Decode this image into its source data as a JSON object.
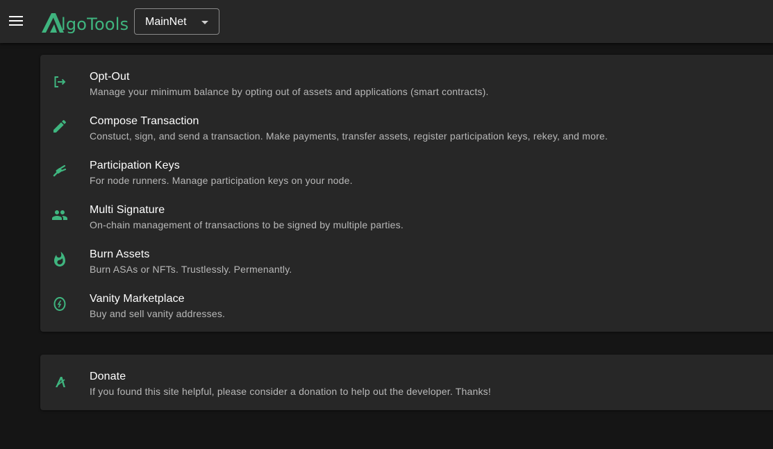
{
  "header": {
    "logo_text": "lgoTools",
    "network_value": "MainNet"
  },
  "tools": [
    {
      "icon": "logout-icon",
      "title": "Opt-Out",
      "description": "Manage your minimum balance by opting out of assets and applications (smart contracts)."
    },
    {
      "icon": "pencil-icon",
      "title": "Compose Transaction",
      "description": "Constuct, sign, and send a transaction. Make payments, transfer assets, register participation keys, rekey, and more."
    },
    {
      "icon": "key-link-icon",
      "title": "Participation Keys",
      "description": "For node runners. Manage participation keys on your node."
    },
    {
      "icon": "people-icon",
      "title": "Multi Signature",
      "description": "On-chain management of transactions to be signed by multiple parties."
    },
    {
      "icon": "fire-icon",
      "title": "Burn Assets",
      "description": "Burn ASAs or NFTs. Trustlessly. Permenantly."
    },
    {
      "icon": "vanity-icon",
      "title": "Vanity Marketplace",
      "description": "Buy and sell vanity addresses."
    }
  ],
  "donate": {
    "icon": "algorand-icon",
    "title": "Donate",
    "description": "If you found this site helpful, please consider a donation to help out the developer. Thanks!"
  },
  "colors": {
    "accent": "#3fb57f",
    "background": "#151515",
    "surface": "#272727"
  }
}
